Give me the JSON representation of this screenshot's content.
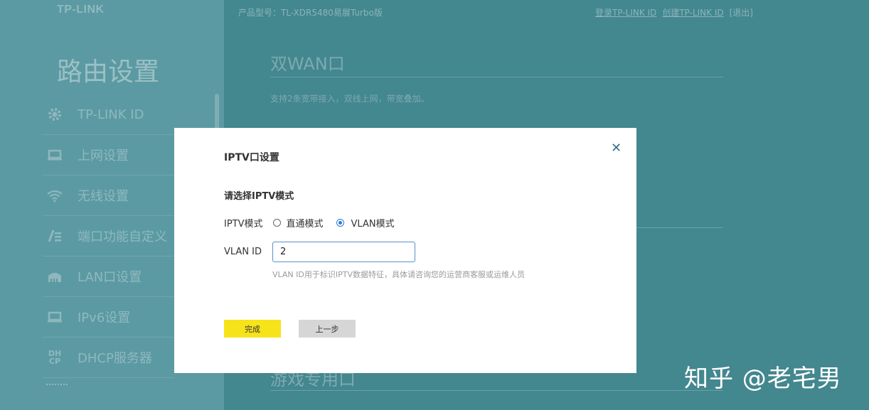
{
  "header": {
    "logo": "TP-LINK",
    "model": "产品型号：TL-XDR5480易展Turbo版",
    "links": [
      "登录TP-LINK ID",
      "创建TP-LINK ID",
      "[退出]"
    ]
  },
  "sidebar": {
    "title": "路由设置",
    "items": [
      {
        "label": "TP-LINK ID",
        "icon": "gear-icon"
      },
      {
        "label": "上网设置",
        "icon": "monitor-icon"
      },
      {
        "label": "无线设置",
        "icon": "wifi-icon"
      },
      {
        "label": "端口功能自定义",
        "icon": "port-icon"
      },
      {
        "label": "LAN口设置",
        "icon": "lan-icon"
      },
      {
        "label": "IPv6设置",
        "icon": "monitor-icon"
      },
      {
        "label": "DHCP服务器",
        "icon": "dhcp-icon"
      }
    ],
    "dhcp_icon_text": "DH CP"
  },
  "main": {
    "section1_title": "双WAN口",
    "section1_desc": "支持2条宽带接入，双线上网，带宽叠加。",
    "section2_title": "游戏专用口"
  },
  "modal": {
    "title": "IPTV口设置",
    "close_icon": "close-icon",
    "subtitle": "请选择IPTV模式",
    "mode_label": "IPTV模式",
    "options": [
      "直通模式",
      "VLAN模式"
    ],
    "selected_option": "VLAN模式",
    "vlan_label": "VLAN ID",
    "vlan_value": "2",
    "vlan_hint": "VLAN ID用于标识IPTV数据特征，具体请咨询您的运营商客服或运维人员",
    "done_button": "完成",
    "prev_button": "上一步"
  },
  "watermark": "知乎 @老宅男",
  "colors": {
    "sidebar_bg": "#5b9aa3",
    "main_bg": "#43878f",
    "done_button": "#f7e31a",
    "prev_button": "#d6d6d6",
    "radio_selected": "#2a7bd4"
  }
}
